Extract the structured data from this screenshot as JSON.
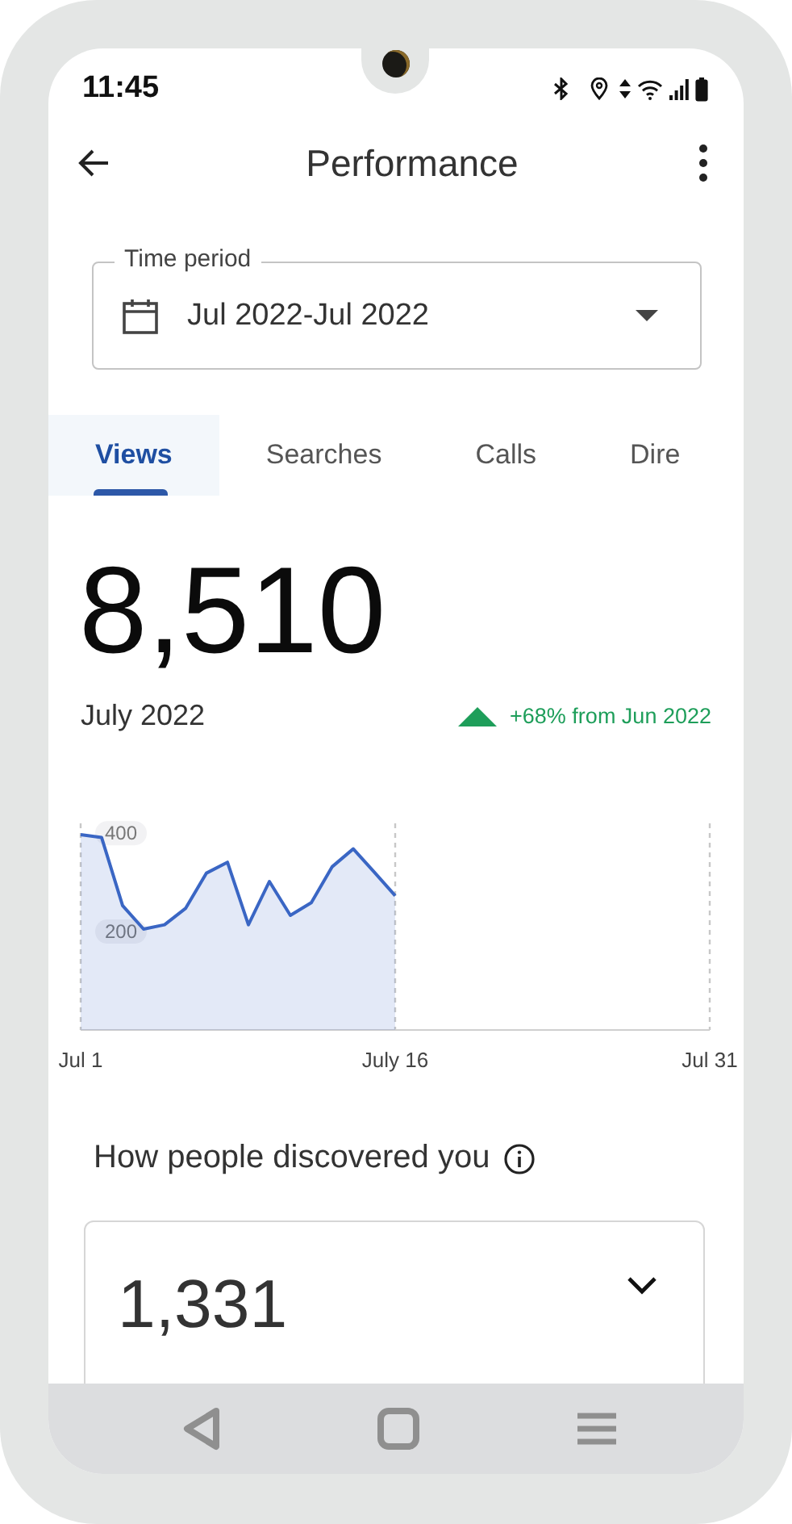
{
  "status_bar": {
    "time": "11:45"
  },
  "app_bar": {
    "title": "Performance"
  },
  "time_period": {
    "label": "Time period",
    "value": "Jul 2022-Jul 2022"
  },
  "tabs": [
    {
      "label": "Views",
      "selected": true
    },
    {
      "label": "Searches",
      "selected": false
    },
    {
      "label": "Calls",
      "selected": false
    },
    {
      "label": "Dire",
      "selected": false
    }
  ],
  "summary": {
    "total": "8,510",
    "period": "July 2022",
    "change": "+68% from Jun 2022",
    "increase": true
  },
  "chart_data": {
    "type": "area",
    "categories": [
      "Jul 1",
      null,
      null,
      null,
      null,
      null,
      null,
      null,
      null,
      null,
      null,
      null,
      null,
      null,
      null,
      "July 16",
      null,
      null,
      null,
      null,
      null,
      null,
      null,
      null,
      null,
      null,
      null,
      null,
      null,
      null,
      "Jul 31"
    ],
    "series": [
      {
        "color": "#3a66c4",
        "values": [
          397,
          391,
          253,
          205,
          214,
          247,
          319,
          341,
          214,
          302,
          233,
          259,
          332,
          368,
          321,
          273,
          null,
          null,
          null,
          null,
          null,
          null,
          null,
          null,
          null,
          null,
          null,
          null,
          null,
          null,
          null
        ]
      }
    ],
    "ylim": [
      0,
      420
    ],
    "yticks": [
      200,
      400
    ]
  },
  "discovery": {
    "heading": "How people discovered you",
    "total": "1,331",
    "expanded": false
  }
}
